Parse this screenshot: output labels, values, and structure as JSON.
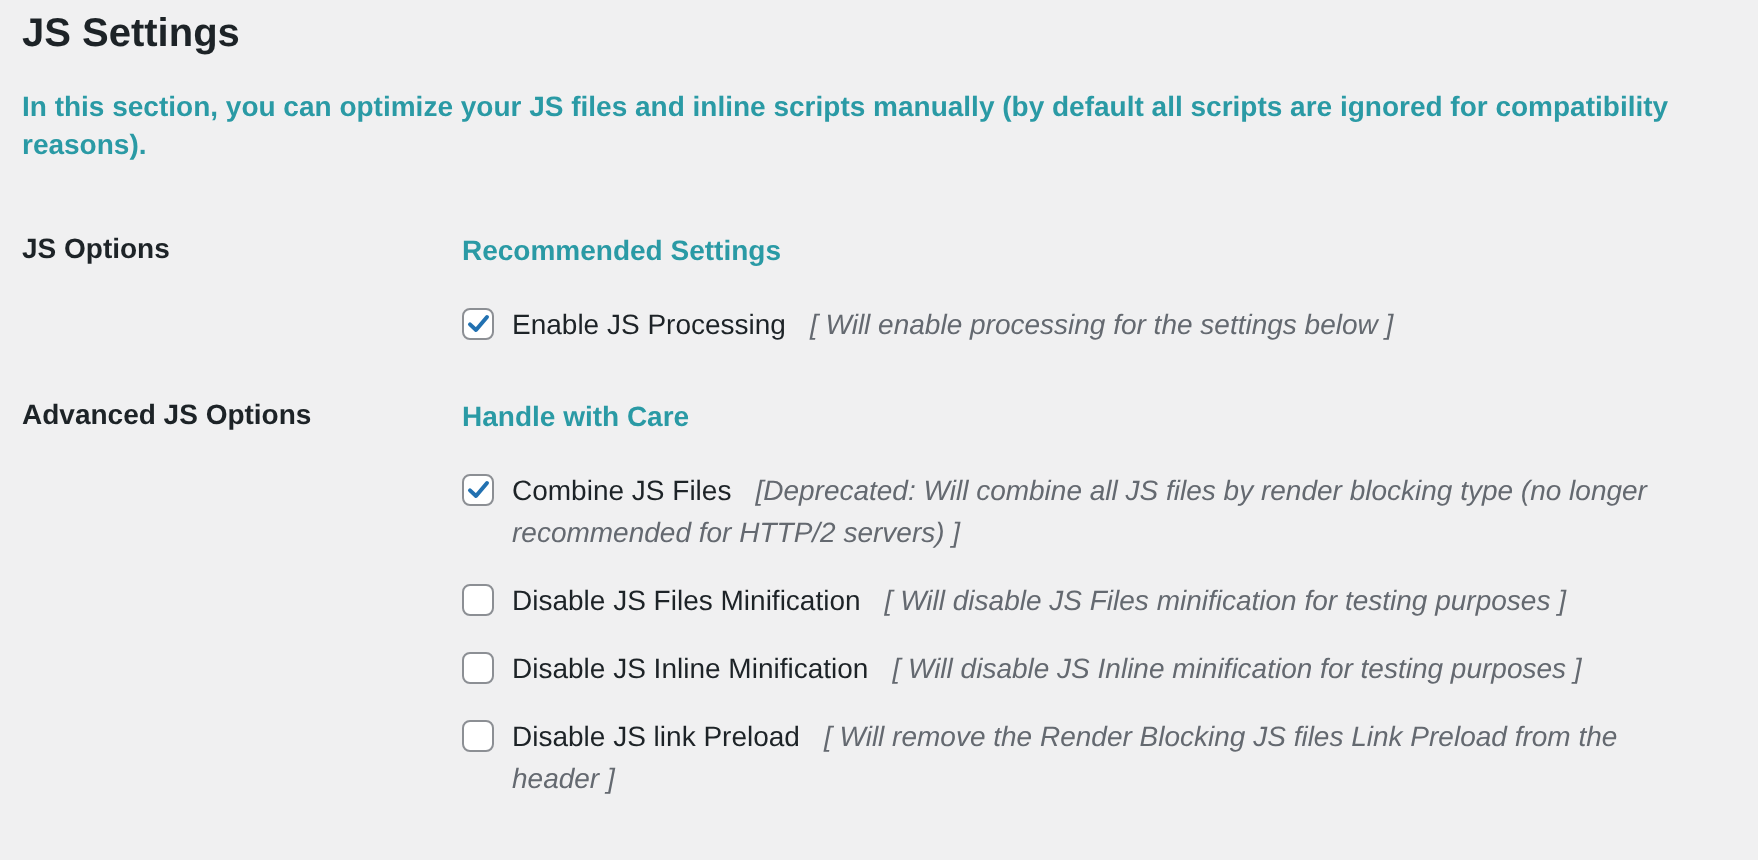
{
  "title": "JS Settings",
  "intro": "In this section, you can optimize your JS files and inline scripts manually (by default all scripts are ignored for compatibility reasons).",
  "sections": [
    {
      "label": "JS Options",
      "heading": "Recommended Settings",
      "options": [
        {
          "label": "Enable JS Processing",
          "description": "[ Will enable processing for the settings below ]",
          "checked": true
        }
      ]
    },
    {
      "label": "Advanced JS Options",
      "heading": "Handle with Care",
      "options": [
        {
          "label": "Combine JS Files",
          "description": "[Deprecated: Will combine all JS files by render blocking type (no longer recommended for HTTP/2 servers) ]",
          "checked": true
        },
        {
          "label": "Disable JS Files Minification",
          "description": "[ Will disable JS Files minification for testing purposes ]",
          "checked": false
        },
        {
          "label": "Disable JS Inline Minification",
          "description": "[ Will disable JS Inline minification for testing purposes ]",
          "checked": false
        },
        {
          "label": "Disable JS link Preload",
          "description": "[ Will remove the Render Blocking JS files Link Preload from the header ]",
          "checked": false
        }
      ]
    }
  ]
}
